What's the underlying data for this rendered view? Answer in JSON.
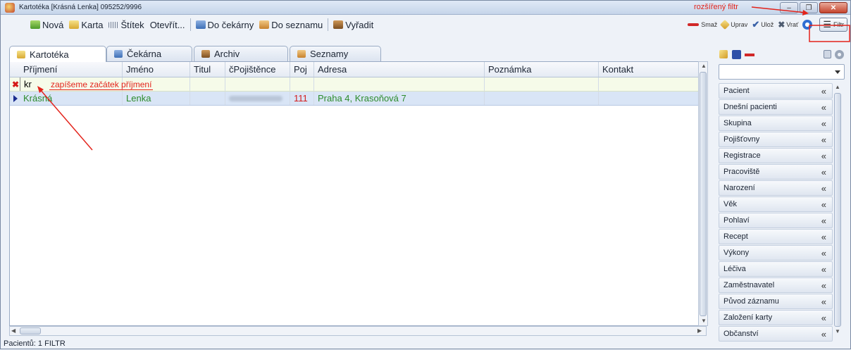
{
  "window": {
    "title": "Kartotéka [Krásná Lenka] 095252/9996",
    "minimize": "–",
    "maximize": "❐",
    "close": "✕"
  },
  "annotations": {
    "extended_filter": "rozšířený filtr",
    "type_surname": "zapíšeme začátek příjmení"
  },
  "toolbar": {
    "new": "Nová",
    "card": "Karta",
    "label": "Štítek",
    "open": "Otevřít...",
    "to_waiting": "Do čekárny",
    "to_list": "Do seznamu",
    "discard": "Vyřadit",
    "delete": "Smaž",
    "edit": "Uprav",
    "save": "Ulož",
    "revert": "Vrať",
    "filter": "Filtr"
  },
  "tabs": [
    "Kartotéka",
    "Čekárna",
    "Archiv",
    "Seznamy"
  ],
  "grid": {
    "columns": [
      "Příjmení",
      "Jméno",
      "Titul",
      "čPojištěnce",
      "Poj",
      "Adresa",
      "Poznámka",
      "Kontakt"
    ],
    "filter_value": "kr",
    "rows": [
      {
        "surname": "Krásná",
        "name": "Lenka",
        "title": "",
        "insured_no": "",
        "insurer": "111",
        "address": "Praha 4, Krasoňová 7",
        "note": "",
        "contact": ""
      }
    ]
  },
  "status": "Pacientů: 1  FILTR",
  "filter_panel": {
    "items": [
      "Pacient",
      "Dnešní pacienti",
      "Skupina",
      "Pojišťovny",
      "Registrace",
      "Pracoviště",
      "Narození",
      "Věk",
      "Pohlaví",
      "Recept",
      "Výkony",
      "Léčiva",
      "Zaměstnavatel",
      "Původ záznamu",
      "Založení karty",
      "Občanství"
    ],
    "chevron": "«"
  }
}
